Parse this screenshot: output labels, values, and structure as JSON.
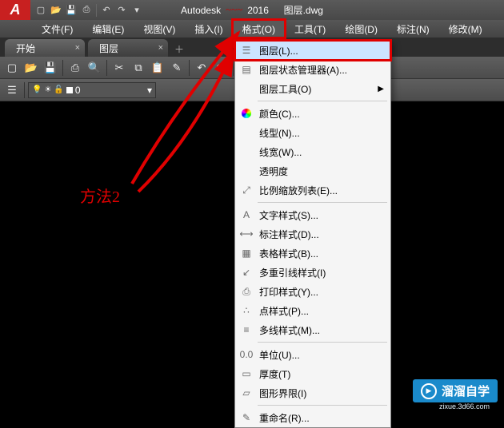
{
  "title": {
    "app": "Autodesk",
    "scribble": "~~~",
    "year": "2016",
    "file": "图层.dwg"
  },
  "menubar": [
    "文件(F)",
    "编辑(E)",
    "视图(V)",
    "插入(I)",
    "格式(O)",
    "工具(T)",
    "绘图(D)",
    "标注(N)",
    "修改(M)"
  ],
  "tabs": [
    {
      "label": "开始"
    },
    {
      "label": "图层"
    }
  ],
  "layerCombo": {
    "value": "0"
  },
  "annotation": "方法2",
  "dropdown": {
    "items": [
      {
        "label": "图层(L)...",
        "icon": "layers",
        "hl": true
      },
      {
        "label": "图层状态管理器(A)...",
        "icon": "layer-state"
      },
      {
        "label": "图层工具(O)",
        "icon": "",
        "sub": true
      },
      {
        "sep": true
      },
      {
        "label": "颜色(C)...",
        "icon": "color"
      },
      {
        "label": "线型(N)...",
        "icon": ""
      },
      {
        "label": "线宽(W)...",
        "icon": ""
      },
      {
        "label": "透明度",
        "icon": ""
      },
      {
        "label": "比例缩放列表(E)...",
        "icon": "scale"
      },
      {
        "sep": true
      },
      {
        "label": "文字样式(S)...",
        "icon": "text"
      },
      {
        "label": "标注样式(D)...",
        "icon": "dim"
      },
      {
        "label": "表格样式(B)...",
        "icon": "table"
      },
      {
        "label": "多重引线样式(I)",
        "icon": "mleader"
      },
      {
        "label": "打印样式(Y)...",
        "icon": "print"
      },
      {
        "label": "点样式(P)...",
        "icon": "point"
      },
      {
        "label": "多线样式(M)...",
        "icon": "mline"
      },
      {
        "sep": true
      },
      {
        "label": "单位(U)...",
        "icon": "units"
      },
      {
        "label": "厚度(T)",
        "icon": "thick"
      },
      {
        "label": "图形界限(I)",
        "icon": "limits"
      },
      {
        "sep": true
      },
      {
        "label": "重命名(R)...",
        "icon": "rename"
      }
    ]
  },
  "watermark": {
    "name": "溜溜自学",
    "url": "zixue.3d66.com"
  }
}
